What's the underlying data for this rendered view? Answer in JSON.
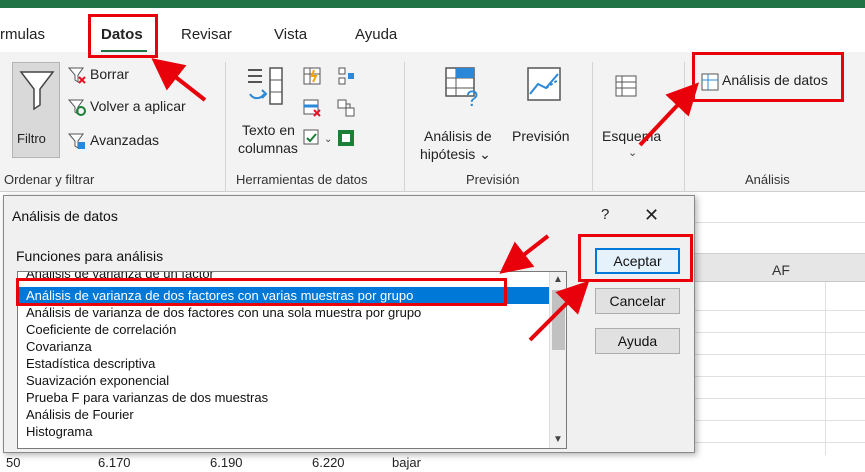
{
  "tabs": {
    "formulas": "rmulas",
    "datos": "Datos",
    "revisar": "Revisar",
    "vista": "Vista",
    "ayuda": "Ayuda"
  },
  "ribbon": {
    "filtro": "Filtro",
    "borrar": "Borrar",
    "volver": "Volver a aplicar",
    "avanzadas": "Avanzadas",
    "texto_en": "Texto en",
    "columnas": "columnas",
    "analisis_de": "Análisis de",
    "hipotesis": "hipótesis ⌄",
    "prevision": "Previsión",
    "esquema": "Esquema",
    "analisis_datos": "Análisis de datos",
    "groups": {
      "ordenar": "Ordenar y filtrar",
      "herramientas": "Herramientas de datos",
      "prevision": "Previsión",
      "analisis": "Análisis"
    }
  },
  "grid": {
    "col_af": "AF",
    "bottom_values": [
      "50",
      "6.170",
      "6.190",
      "6.220",
      "bajar"
    ]
  },
  "dialog": {
    "title": "Análisis de datos",
    "help": "?",
    "close": "✕",
    "list_label": "Funciones para análisis",
    "items": [
      "Análisis de varianza de un factor",
      "Análisis de varianza de dos factores con varias muestras por grupo",
      "Análisis de varianza de dos factores con una sola muestra por grupo",
      "Coeficiente de correlación",
      "Covarianza",
      "Estadística descriptiva",
      "Suavización exponencial",
      "Prueba F para varianzas de dos muestras",
      "Análisis de Fourier",
      "Histograma"
    ],
    "buttons": {
      "aceptar": "Aceptar",
      "cancelar": "Cancelar",
      "ayuda": "Ayuda"
    }
  },
  "colors": {
    "excel_green": "#217346",
    "selection_blue": "#0078d7",
    "annotation_red": "#e8000b"
  }
}
